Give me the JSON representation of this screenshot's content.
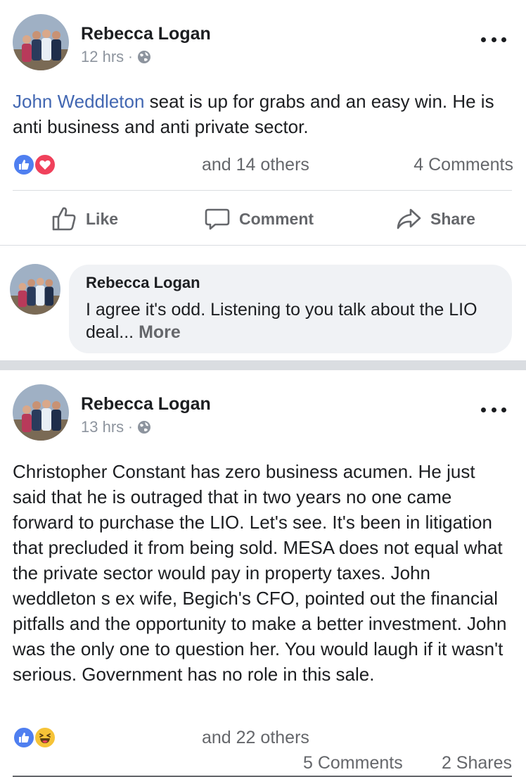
{
  "posts": [
    {
      "author": "Rebecca Logan",
      "time": "12 hrs",
      "separator": "·",
      "text_link": "John Weddleton",
      "text_rest": " seat is up for grabs and an easy win. He is anti business and anti private sector.",
      "reactions": {
        "icons": [
          "like-icon",
          "love-icon"
        ],
        "others": "and 14 others",
        "comments": "4 Comments"
      },
      "actions": {
        "like": "Like",
        "comment": "Comment",
        "share": "Share"
      },
      "top_comment": {
        "author": "Rebecca Logan",
        "text": "I agree it's odd. Listening to you talk about the LIO deal...",
        "more": "More"
      }
    },
    {
      "author": "Rebecca Logan",
      "time": "13 hrs",
      "separator": "·",
      "text": "Christopher Constant has zero business acumen. He just said that he is outraged that in two years no one came forward to purchase the LIO. Let's see. It's been in litigation that precluded it from being sold. MESA does not equal what the private sector would pay in property taxes. John weddleton s ex wife, Begich's CFO, pointed out the financial pitfalls and the opportunity to make a better investment. John was the only one to question her. You would laugh if it wasn't serious. Government has no role in this sale.",
      "reactions": {
        "icons": [
          "like-icon",
          "haha-icon"
        ],
        "others": "and 22 others",
        "comments": "5 Comments",
        "shares": "2 Shares"
      }
    }
  ],
  "colors": {
    "link": "#4267b2",
    "like": "#4f7ff0",
    "love": "#f0415b",
    "haha": "#f6c337",
    "secondary_text": "#65676b",
    "divider": "#dadde1"
  }
}
